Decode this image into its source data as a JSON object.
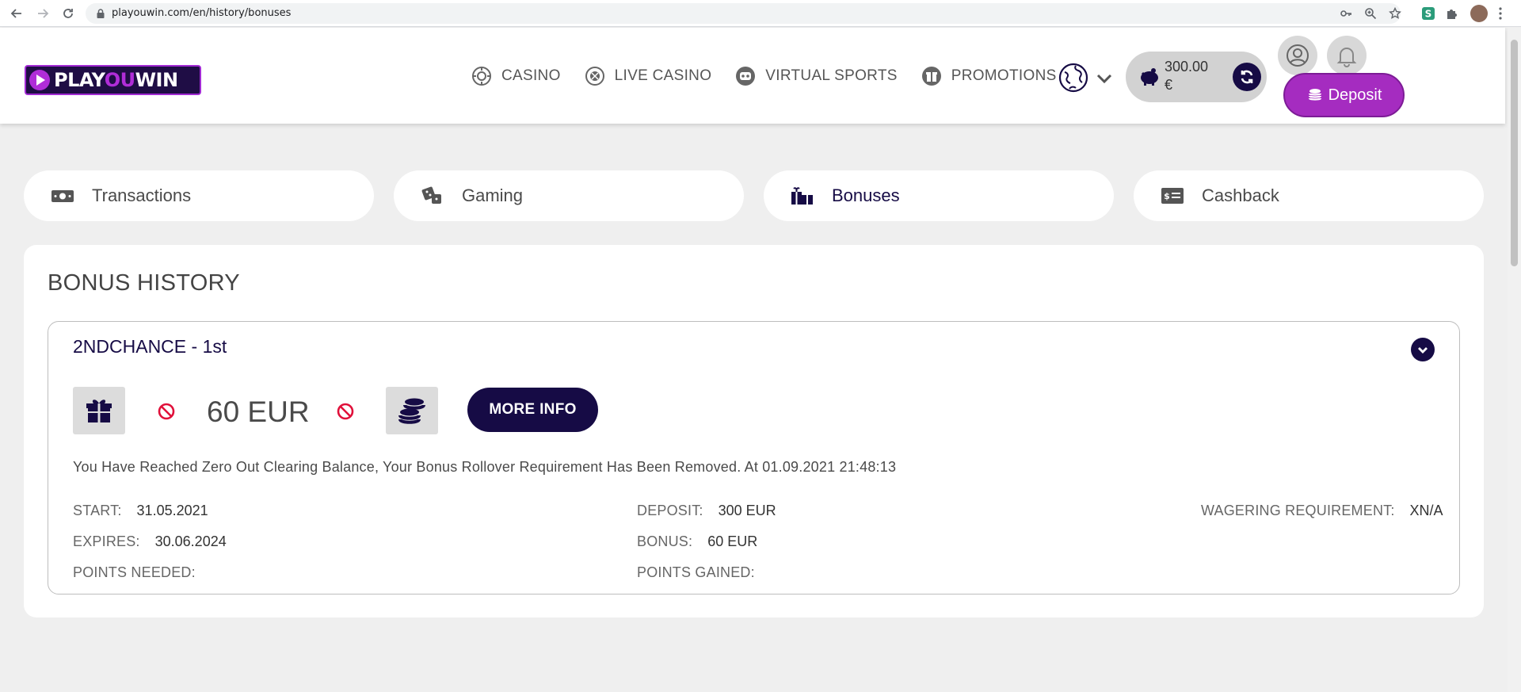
{
  "browser": {
    "url": "playouwin.com/en/history/bonuses"
  },
  "header": {
    "logo": {
      "part1": "PLAY",
      "part2": "OU",
      "part3": "WIN"
    },
    "nav": [
      {
        "label": "CASINO",
        "icon": "casino-chip-icon"
      },
      {
        "label": "LIVE CASINO",
        "icon": "roulette-icon"
      },
      {
        "label": "VIRTUAL SPORTS",
        "icon": "robot-icon"
      },
      {
        "label": "PROMOTIONS",
        "icon": "gift-icon"
      }
    ],
    "balance": {
      "amount": "300.00",
      "currency": "€"
    },
    "deposit_label": "Deposit"
  },
  "tabs": [
    {
      "label": "Transactions",
      "icon": "money-icon",
      "active": false
    },
    {
      "label": "Gaming",
      "icon": "dice-icon",
      "active": false
    },
    {
      "label": "Bonuses",
      "icon": "gifts-icon",
      "active": true
    },
    {
      "label": "Cashback",
      "icon": "cashback-card-icon",
      "active": false
    }
  ],
  "bonus_history": {
    "title": "BONUS HISTORY",
    "bonus": {
      "name": "2NDCHANCE - 1st",
      "amount": "60 EUR",
      "more_info_label": "MORE INFO",
      "message": "You Have Reached Zero Out Clearing Balance, Your Bonus Rollover Requirement Has Been Removed. At 01.09.2021 21:48:13",
      "start_label": "START:",
      "start_value": "31.05.2021",
      "expires_label": "EXPIRES:",
      "expires_value": "30.06.2024",
      "points_needed_label": "POINTS NEEDED:",
      "points_needed_value": "",
      "deposit_label": "DEPOSIT:",
      "deposit_value": "300 EUR",
      "bonus_label": "BONUS:",
      "bonus_value": "60 EUR",
      "points_gained_label": "POINTS GAINED:",
      "points_gained_value": "",
      "wagering_label": "WAGERING REQUIREMENT:",
      "wagering_value": "XN/A"
    }
  },
  "colors": {
    "brand_dark": "#160b45",
    "brand_purple": "#a52cc0",
    "warning_red": "#e0103a",
    "background": "#efefef"
  }
}
